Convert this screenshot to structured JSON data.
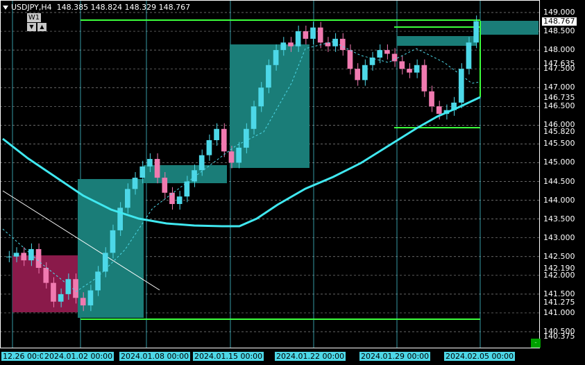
{
  "window": {
    "symbol": "USDJPY,H4",
    "ohlc": "148.385 148.824 148.329 148.767",
    "timeframe_badge": "W1",
    "nav_left": "▼",
    "nav_right": "▲"
  },
  "colors": {
    "background": "#000000",
    "bull_candle": "#4dd8e8",
    "bear_candle": "#f07ab0",
    "ma_slow": "#40e8f0",
    "level_lines": "#3cff3c",
    "zone_teal": "#1a7d78",
    "zone_maroon": "#8a1a4a"
  },
  "price_axis": {
    "labels": [
      "149.000",
      "148.500",
      "148.000",
      "147.635",
      "147.500",
      "147.000",
      "146.735",
      "146.500",
      "146.000",
      "145.820",
      "145.500",
      "145.000",
      "144.500",
      "144.000",
      "143.500",
      "143.000",
      "142.500",
      "142.190",
      "142.000",
      "141.500",
      "141.275",
      "141.000",
      "140.500",
      "140.375"
    ],
    "current_price": "148.767"
  },
  "time_axis": {
    "labels": [
      "12.26 00:00",
      "2024.01.02 00:00",
      "2024.01.08 00:00",
      "2024.01.15 00:00",
      "2024.01.22 00:00",
      "2024.01.29 00:00",
      "2024.02.05 00:00"
    ]
  },
  "chart_data": {
    "type": "candlestick",
    "title": "USDJPY,H4",
    "ylim": [
      140.2,
      149.3
    ],
    "x_labels": [
      "12.26 00:00",
      "2024.01.02 00:00",
      "2024.01.08 00:00",
      "2024.01.15 00:00",
      "2024.01.22 00:00",
      "2024.01.29 00:00",
      "2024.02.05 00:00"
    ],
    "levels": [
      148.85,
      140.8,
      148.7,
      145.85
    ],
    "ma_slow": [
      145.5,
      144.9,
      144.3,
      143.8,
      143.5,
      143.3,
      143.3,
      143.6,
      144.2,
      144.8,
      145.4,
      145.9,
      146.4,
      146.7
    ],
    "ma_fast_note": "dashed"
  },
  "corner": {
    "label": "-"
  }
}
